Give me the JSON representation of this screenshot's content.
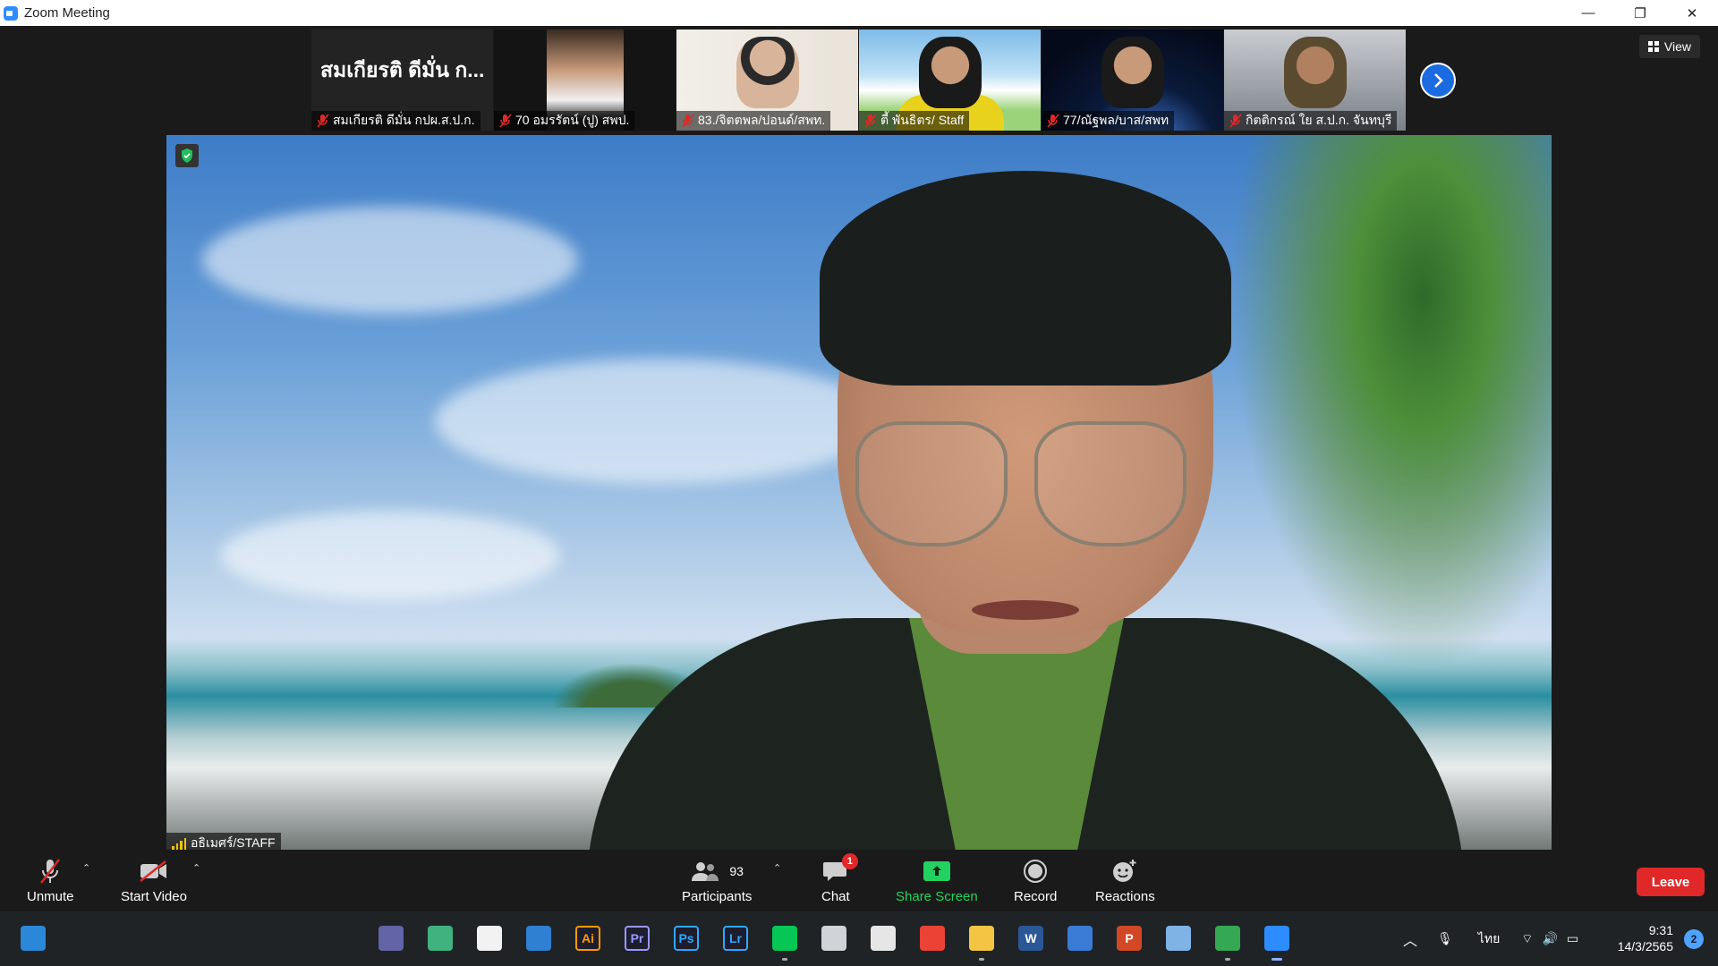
{
  "window": {
    "title": "Zoom Meeting",
    "minimize": "—",
    "restore": "❐",
    "close": "✕"
  },
  "gallery": {
    "view_label": "View",
    "participants": [
      {
        "display_text": "สมเกียรติ ดีมั่น ก...",
        "name": "สมเกียรติ ดีมั่น กปผ.ส.ป.ก.",
        "muted": true
      },
      {
        "name": "70 อมรรัตน์ (ปู) สพป.",
        "muted": true
      },
      {
        "name": "83./จิตตพล/ปอนด์/สพท.",
        "muted": true
      },
      {
        "name": "ตี้ พันธิตร/ Staff",
        "muted": true
      },
      {
        "name": "77/ณัฐพล/บาส/สพท",
        "muted": true
      },
      {
        "name": "กิตติกรณ์  ใย ส.ป.ก. จันทบุรี",
        "muted": true
      }
    ]
  },
  "speaker": {
    "name": "อธิเมศร์/STAFF"
  },
  "controls": {
    "unmute": "Unmute",
    "start_video": "Start Video",
    "participants_label": "Participants",
    "participants_count": "93",
    "chat": "Chat",
    "chat_badge": "1",
    "share_screen": "Share Screen",
    "record": "Record",
    "reactions": "Reactions",
    "leave": "Leave"
  },
  "taskbar": {
    "apps": [
      {
        "icon": "start-icon",
        "label": "",
        "color": "#2b88d8"
      },
      {
        "icon": "teams-icon",
        "label": "",
        "color": "#6264a7"
      },
      {
        "icon": "notepad-icon",
        "label": "",
        "color": "#3fb27f"
      },
      {
        "icon": "store-icon",
        "label": "",
        "color": "#f2f2f2"
      },
      {
        "icon": "outlook-icon",
        "label": "",
        "color": "#2f7fd2"
      },
      {
        "icon": "illustrator-icon",
        "label": "Ai",
        "color": "#ff9a00"
      },
      {
        "icon": "premiere-icon",
        "label": "Pr",
        "color": "#9999ff"
      },
      {
        "icon": "photoshop-icon",
        "label": "Ps",
        "color": "#31a8ff"
      },
      {
        "icon": "lightroom-icon",
        "label": "Lr",
        "color": "#31a8ff"
      },
      {
        "icon": "line-icon",
        "label": "",
        "color": "#06c755"
      },
      {
        "icon": "notes-icon",
        "label": "",
        "color": "#d0d4d8"
      },
      {
        "icon": "snipping-icon",
        "label": "",
        "color": "#e6e6e6"
      },
      {
        "icon": "chrome-icon",
        "label": "",
        "color": "#ea4335"
      },
      {
        "icon": "explorer-icon",
        "label": "",
        "color": "#f4c542"
      },
      {
        "icon": "word-icon",
        "label": "W",
        "color": "#2b5797"
      },
      {
        "icon": "vpn-icon",
        "label": "",
        "color": "#3a7bd5"
      },
      {
        "icon": "powerpoint-icon",
        "label": "P",
        "color": "#d24726"
      },
      {
        "icon": "monitor-icon",
        "label": "",
        "color": "#7fb2e5"
      },
      {
        "icon": "chrome-profile-icon",
        "label": "",
        "color": "#34a853"
      },
      {
        "icon": "zoom-icon",
        "label": "",
        "color": "#2d8cff"
      }
    ],
    "language": "ไทย",
    "time": "9:31",
    "date": "14/3/2565",
    "notifications": "2"
  }
}
